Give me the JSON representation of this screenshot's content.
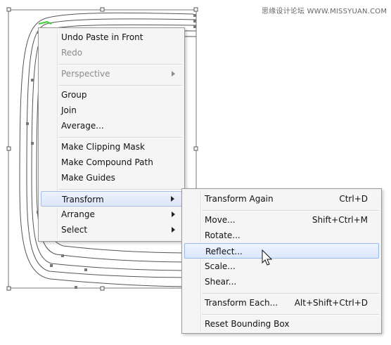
{
  "watermark": {
    "text": "思缘设计论坛 WWW.MISSYUAN.COM"
  },
  "colors": {
    "menu_background": "#f5f5f5",
    "menu_border": "#9a9a9a",
    "highlight_background": "#dbe7fb",
    "highlight_border": "#9ab8e6",
    "disabled_text": "#8a8a8a",
    "canvas_path": "#555555",
    "selection_green": "#32d132"
  },
  "context_menu": {
    "items": [
      {
        "label": "Undo Paste in Front",
        "disabled": false,
        "submenu": false
      },
      {
        "label": "Redo",
        "disabled": true,
        "submenu": false
      },
      {
        "label": "Perspective",
        "disabled": true,
        "submenu": true
      },
      {
        "label": "Group",
        "disabled": false,
        "submenu": false
      },
      {
        "label": "Join",
        "disabled": false,
        "submenu": false
      },
      {
        "label": "Average...",
        "disabled": false,
        "submenu": false
      },
      {
        "label": "Make Clipping Mask",
        "disabled": false,
        "submenu": false
      },
      {
        "label": "Make Compound Path",
        "disabled": false,
        "submenu": false
      },
      {
        "label": "Make Guides",
        "disabled": false,
        "submenu": false
      },
      {
        "label": "Transform",
        "disabled": false,
        "submenu": true,
        "open": true
      },
      {
        "label": "Arrange",
        "disabled": false,
        "submenu": true
      },
      {
        "label": "Select",
        "disabled": false,
        "submenu": true
      }
    ]
  },
  "transform_submenu": {
    "items": [
      {
        "label": "Transform Again",
        "shortcut": "Ctrl+D"
      },
      {
        "label": "Move...",
        "shortcut": "Shift+Ctrl+M"
      },
      {
        "label": "Rotate...",
        "shortcut": ""
      },
      {
        "label": "Reflect...",
        "shortcut": "",
        "hover": true
      },
      {
        "label": "Scale...",
        "shortcut": ""
      },
      {
        "label": "Shear...",
        "shortcut": ""
      },
      {
        "label": "Transform Each...",
        "shortcut": "Alt+Shift+Ctrl+D"
      },
      {
        "label": "Reset Bounding Box",
        "shortcut": ""
      }
    ]
  },
  "icons": {
    "submenu_arrow": "chevron-right-icon",
    "cursor": "mouse-pointer-icon"
  }
}
